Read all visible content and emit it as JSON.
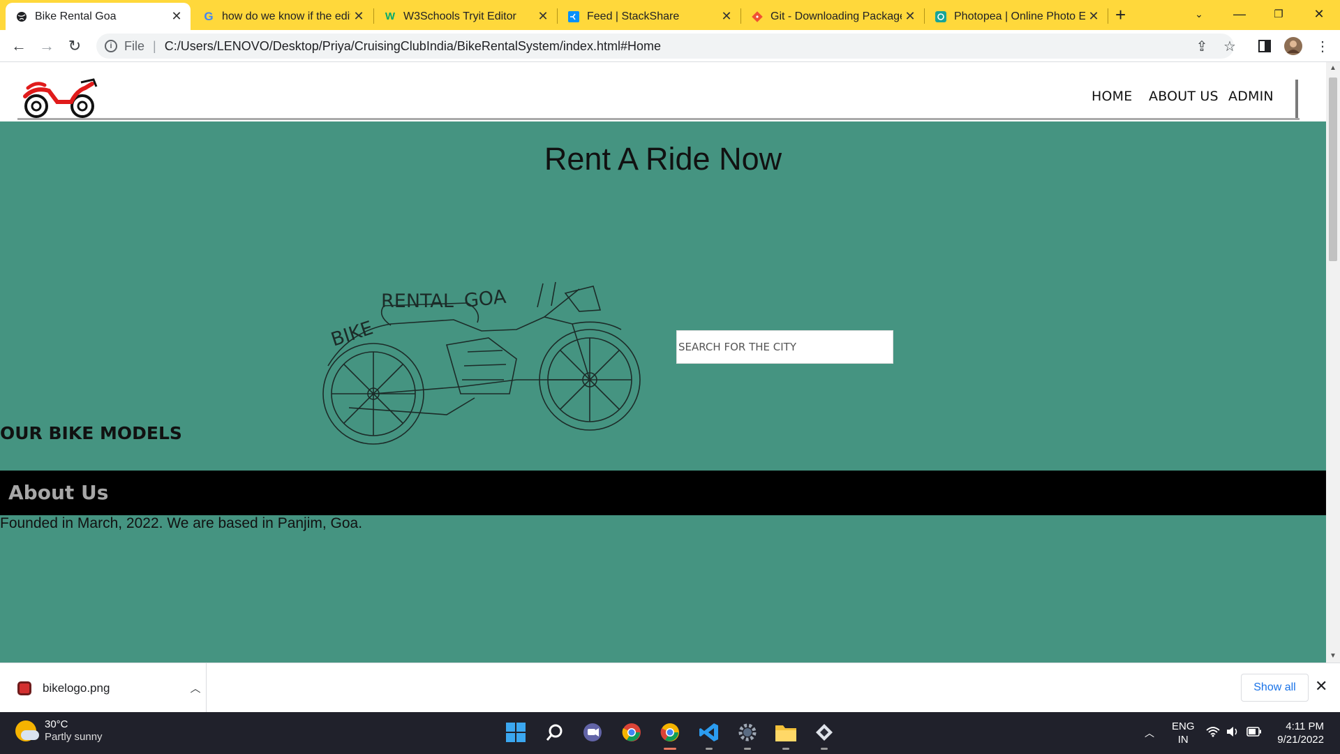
{
  "browser": {
    "tabs": [
      {
        "title": "Bike Rental Goa",
        "favicon": "globe-icon",
        "active": true
      },
      {
        "title": "how do we know if the edit",
        "favicon": "google-g-icon",
        "active": false
      },
      {
        "title": "W3Schools Tryit Editor",
        "favicon": "w3schools-icon",
        "active": false
      },
      {
        "title": "Feed | StackShare",
        "favicon": "stackshare-icon",
        "active": false
      },
      {
        "title": "Git - Downloading Package",
        "favicon": "git-icon",
        "active": false
      },
      {
        "title": "Photopea | Online Photo Ed",
        "favicon": "photopea-icon",
        "active": false
      }
    ],
    "new_tab": "+",
    "address": {
      "scheme_label": "File",
      "url": "C:/Users/LENOVO/Desktop/Priya/CruisingClubIndia/BikeRentalSystem/index.html#Home"
    }
  },
  "page": {
    "nav": [
      "HOME",
      "ABOUT US",
      "ADMIN"
    ],
    "hero_title": "Rent A Ride Now",
    "bike_art_words": [
      "BIKE",
      "RENTAL",
      "GOA"
    ],
    "search_placeholder": "SEARCH FOR THE CITY",
    "models_title": "OUR BIKE MODELS",
    "about_title": "About Us",
    "about_text": "Founded in March, 2022. We are based in Panjim, Goa.",
    "colors": {
      "teal": "#459481",
      "about_bar": "#000000"
    }
  },
  "download_shelf": {
    "file_name": "bikelogo.png",
    "show_all": "Show all"
  },
  "taskbar": {
    "weather_temp": "30°C",
    "weather_desc": "Partly sunny",
    "lang_line1": "ENG",
    "lang_line2": "IN",
    "time": "4:11 PM",
    "date": "9/21/2022"
  }
}
